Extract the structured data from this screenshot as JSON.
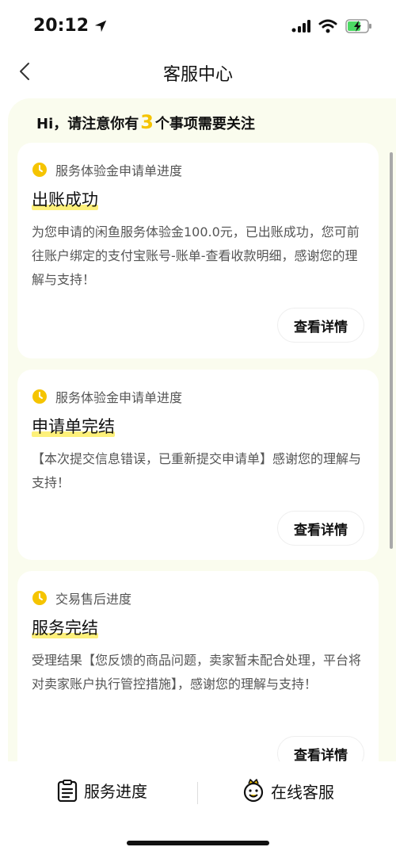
{
  "status_bar": {
    "time": "20:12"
  },
  "nav": {
    "title": "客服中心"
  },
  "notice": {
    "prefix": "Hi，请注意你有",
    "count": "3",
    "suffix": "个事项需要关注"
  },
  "cards": [
    {
      "category": "服务体验金申请单进度",
      "title": "出账成功",
      "body": "为您申请的闲鱼服务体验金100.0元，已出账成功，您可前往账户绑定的支付宝账号-账单-查看收款明细，感谢您的理解与支持！",
      "button": "查看详情"
    },
    {
      "category": "服务体验金申请单进度",
      "title": "申请单完结",
      "body": "【本次提交信息错误，已重新提交申请单】感谢您的理解与支持！",
      "button": "查看详情"
    },
    {
      "category": "交易售后进度",
      "title": "服务完结",
      "body": "受理结果【您反馈的商品问题，卖家暂未配合处理，平台将对卖家账户执行管控措施】，感谢您的理解与支持！",
      "button": "查看详情"
    }
  ],
  "bottom_bar": {
    "progress_label": "服务进度",
    "chat_label": "在线客服"
  },
  "colors": {
    "accent": "#f5c400",
    "highlight": "#fdf07a",
    "panel_bg": "#fafcee"
  }
}
